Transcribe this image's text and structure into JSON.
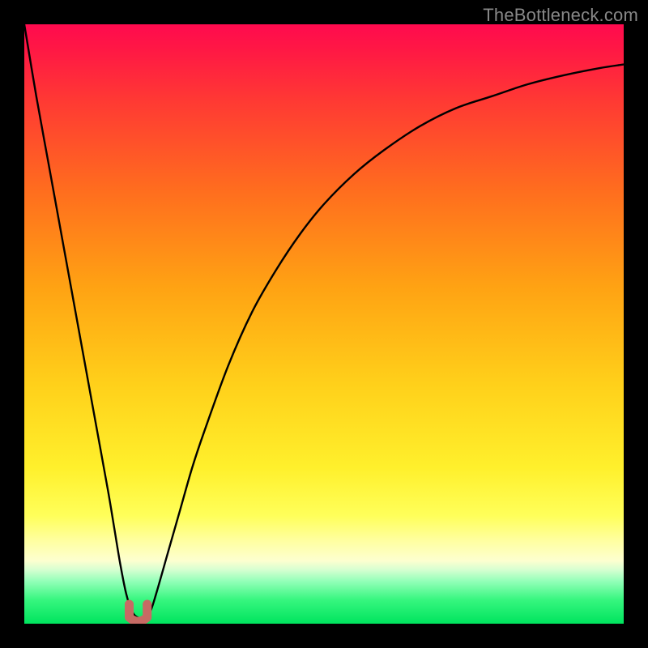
{
  "watermark": "TheBottleneck.com",
  "chart_data": {
    "type": "line",
    "title": "",
    "xlabel": "",
    "ylabel": "",
    "xlim": [
      0,
      100
    ],
    "ylim": [
      0,
      100
    ],
    "x": [
      0,
      2,
      4,
      6,
      8,
      10,
      12,
      14,
      15,
      16,
      17,
      18,
      19,
      20,
      21,
      22,
      24,
      26,
      28,
      30,
      34,
      38,
      42,
      46,
      50,
      55,
      60,
      66,
      72,
      78,
      84,
      90,
      96,
      100
    ],
    "y": [
      100,
      88,
      77,
      66,
      55,
      44,
      33,
      22,
      16,
      10,
      5,
      2,
      1,
      1,
      2,
      5,
      12,
      19,
      26,
      32,
      43,
      52,
      59,
      65,
      70,
      75,
      79,
      83,
      86,
      88,
      90,
      91.5,
      92.7,
      93.3
    ],
    "notch_marker": {
      "x_center": 19,
      "y": 0.8,
      "width": 3,
      "color": "#c66a64"
    }
  }
}
